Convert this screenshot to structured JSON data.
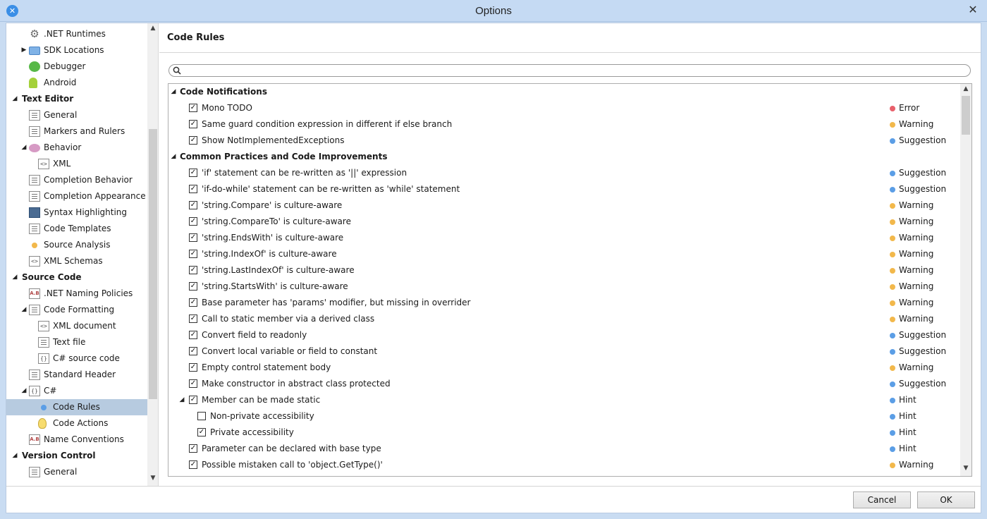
{
  "window": {
    "title": "Options",
    "close_glyph": "✕",
    "app_icon_glyph": "✕"
  },
  "tree": {
    "items": [
      {
        "label": ".NET Runtimes",
        "level": 2,
        "icon": "gear-icon",
        "expander": ""
      },
      {
        "label": "SDK Locations",
        "level": 2,
        "icon": "folder-icon",
        "expander": "▶"
      },
      {
        "label": "Debugger",
        "level": 2,
        "icon": "debugger-icon",
        "expander": ""
      },
      {
        "label": "Android",
        "level": 2,
        "icon": "android-icon",
        "expander": ""
      },
      {
        "label": "Text Editor",
        "level": 1,
        "icon": "",
        "expander": "◢",
        "category": true
      },
      {
        "label": "General",
        "level": 2,
        "icon": "page-icon",
        "expander": ""
      },
      {
        "label": "Markers and Rulers",
        "level": 2,
        "icon": "page-icon",
        "expander": ""
      },
      {
        "label": "Behavior",
        "level": 2,
        "icon": "brain-icon",
        "expander": "◢"
      },
      {
        "label": "XML",
        "level": 3,
        "icon": "xml-code-icon",
        "expander": ""
      },
      {
        "label": "Completion Behavior",
        "level": 2,
        "icon": "page-icon",
        "expander": ""
      },
      {
        "label": "Completion Appearance",
        "level": 2,
        "icon": "page-icon",
        "expander": ""
      },
      {
        "label": "Syntax Highlighting",
        "level": 2,
        "icon": "syntax-icon",
        "expander": ""
      },
      {
        "label": "Code Templates",
        "level": 2,
        "icon": "page-icon",
        "expander": ""
      },
      {
        "label": "Source Analysis",
        "level": 2,
        "icon": "orange-dot-icon",
        "expander": ""
      },
      {
        "label": "XML Schemas",
        "level": 2,
        "icon": "xml-code-icon",
        "expander": ""
      },
      {
        "label": "Source Code",
        "level": 1,
        "icon": "",
        "expander": "◢",
        "category": true
      },
      {
        "label": ".NET Naming Policies",
        "level": 2,
        "icon": "naming-ab-icon",
        "expander": ""
      },
      {
        "label": "Code Formatting",
        "level": 2,
        "icon": "page-icon",
        "expander": "◢"
      },
      {
        "label": "XML document",
        "level": 3,
        "icon": "xml-code-icon",
        "expander": ""
      },
      {
        "label": "Text file",
        "level": 3,
        "icon": "page-icon",
        "expander": ""
      },
      {
        "label": "C# source code",
        "level": 3,
        "icon": "braces-code-icon",
        "expander": ""
      },
      {
        "label": "Standard Header",
        "level": 2,
        "icon": "page-icon",
        "expander": ""
      },
      {
        "label": "C#",
        "level": 2,
        "icon": "braces-code-icon",
        "expander": "◢"
      },
      {
        "label": "Code Rules",
        "level": 3,
        "icon": "blue-dot-icon",
        "expander": "",
        "selected": true
      },
      {
        "label": "Code Actions",
        "level": 3,
        "icon": "lightbulb-icon",
        "expander": ""
      },
      {
        "label": "Name Conventions",
        "level": 2,
        "icon": "naming-ab-icon",
        "expander": ""
      },
      {
        "label": "Version Control",
        "level": 1,
        "icon": "",
        "expander": "◢",
        "category": true
      },
      {
        "label": "General",
        "level": 2,
        "icon": "page-icon",
        "expander": ""
      }
    ]
  },
  "panel": {
    "title": "Code Rules",
    "search_value": "",
    "search_placeholder": ""
  },
  "severity_colors": {
    "Error": "#e8606b",
    "Warning": "#f2b84b",
    "Suggestion": "#5b9ee6",
    "Hint": "#5b9ee6"
  },
  "rules": [
    {
      "text": "Code Notifications",
      "category": true,
      "expander": "◢"
    },
    {
      "text": "Mono TODO",
      "checked": true,
      "severity": "Error"
    },
    {
      "text": "Same guard condition expression in different if else branch",
      "checked": true,
      "severity": "Warning"
    },
    {
      "text": "Show NotImplementedExceptions",
      "checked": true,
      "severity": "Suggestion"
    },
    {
      "text": "Common Practices and Code Improvements",
      "category": true,
      "expander": "◢"
    },
    {
      "text": "'if' statement can be re-written as '||' expression",
      "checked": true,
      "severity": "Suggestion"
    },
    {
      "text": "'if-do-while' statement can be re-written as 'while' statement",
      "checked": true,
      "severity": "Suggestion"
    },
    {
      "text": "'string.Compare' is culture-aware",
      "checked": true,
      "severity": "Warning"
    },
    {
      "text": "'string.CompareTo' is culture-aware",
      "checked": true,
      "severity": "Warning"
    },
    {
      "text": "'string.EndsWith' is culture-aware",
      "checked": true,
      "severity": "Warning"
    },
    {
      "text": "'string.IndexOf' is culture-aware",
      "checked": true,
      "severity": "Warning"
    },
    {
      "text": "'string.LastIndexOf' is culture-aware",
      "checked": true,
      "severity": "Warning"
    },
    {
      "text": "'string.StartsWith' is culture-aware",
      "checked": true,
      "severity": "Warning"
    },
    {
      "text": "Base parameter has 'params' modifier, but missing in overrider",
      "checked": true,
      "severity": "Warning"
    },
    {
      "text": "Call to static member via a derived class",
      "checked": true,
      "severity": "Warning"
    },
    {
      "text": "Convert field to readonly",
      "checked": true,
      "severity": "Suggestion"
    },
    {
      "text": "Convert local variable or field to constant",
      "checked": true,
      "severity": "Suggestion"
    },
    {
      "text": "Empty control statement body",
      "checked": true,
      "severity": "Warning"
    },
    {
      "text": "Make constructor in abstract class protected",
      "checked": true,
      "severity": "Suggestion"
    },
    {
      "text": "Member can be made static",
      "checked": true,
      "severity": "Hint",
      "expander": "◢"
    },
    {
      "text": "Non-private accessibility",
      "checked": false,
      "severity": "Hint",
      "sub": true
    },
    {
      "text": "Private accessibility",
      "checked": true,
      "severity": "Hint",
      "sub": true
    },
    {
      "text": "Parameter can be declared with base type",
      "checked": true,
      "severity": "Hint"
    },
    {
      "text": "Possible mistaken call to 'object.GetType()'",
      "checked": true,
      "severity": "Warning"
    }
  ],
  "footer": {
    "cancel_label": "Cancel",
    "ok_label": "OK"
  }
}
